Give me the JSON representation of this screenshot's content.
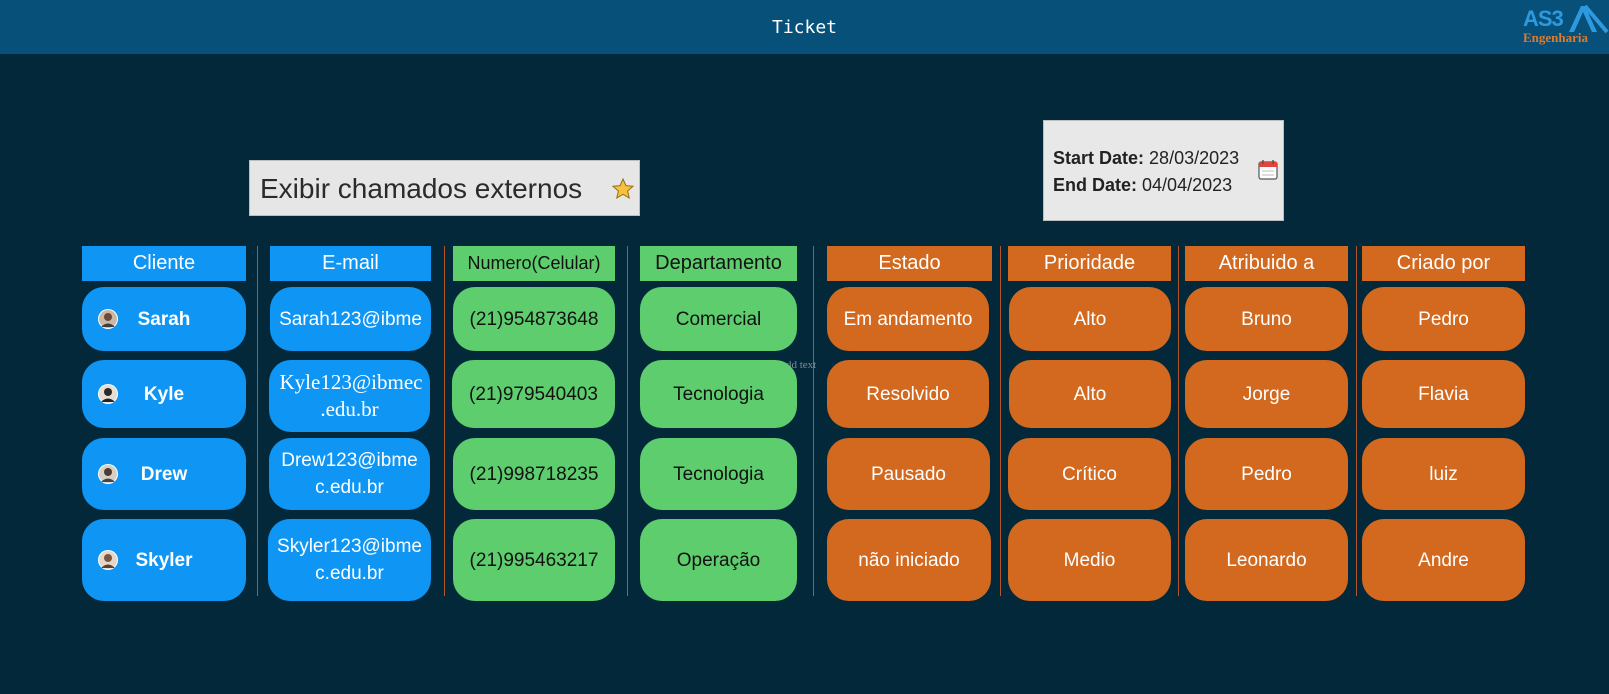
{
  "app": {
    "title": "Ticket"
  },
  "logo": {
    "line1": "AS3",
    "line2": "Engenharia",
    "accent": "#2d9ae0",
    "secondary": "#e07a2a"
  },
  "filter": {
    "label": "Exibir chamados externos",
    "icon": "star-icon"
  },
  "dates": {
    "start_label": "Start Date:",
    "start_value": "28/03/2023",
    "end_label": "End Date:",
    "end_value": "04/04/2023",
    "icon": "calendar-icon"
  },
  "placeholder_text": "Add text",
  "colors": {
    "background": "#022839",
    "topbar": "#06507a",
    "blue": "#0f96f5",
    "green": "#5dcd6e",
    "orange": "#d2691e"
  },
  "columns": [
    "Cliente",
    "E-mail",
    "Numero(Celular)",
    "Departamento",
    "Estado",
    "Prioridade",
    "Atribuido a",
    "Criado por"
  ],
  "rows": [
    {
      "cliente": "Sarah",
      "email": "Sarah123@ibme",
      "numero": "(21)954873648",
      "departamento": "Comercial",
      "estado": "Em andamento",
      "prioridade": "Alto",
      "atribuido": "Bruno",
      "criado": "Pedro"
    },
    {
      "cliente": "Kyle",
      "email": "Kyle123@ibmec .edu.br",
      "numero": "(21)979540403",
      "departamento": "Tecnologia",
      "estado": "Resolvido",
      "prioridade": "Alto",
      "atribuido": "Jorge",
      "criado": "Flavia"
    },
    {
      "cliente": "Drew",
      "email": "Drew123@ibme c.edu.br",
      "numero": "(21)998718235",
      "departamento": "Tecnologia",
      "estado": "Pausado",
      "prioridade": "Crítico",
      "atribuido": "Pedro",
      "criado": "luiz"
    },
    {
      "cliente": "Skyler",
      "email": "Skyler123@ibme c.edu.br",
      "numero": "(21)995463217",
      "departamento": "Operação",
      "estado": "não iniciado",
      "prioridade": "Medio",
      "atribuido": "Leonardo",
      "criado": "Andre"
    }
  ]
}
